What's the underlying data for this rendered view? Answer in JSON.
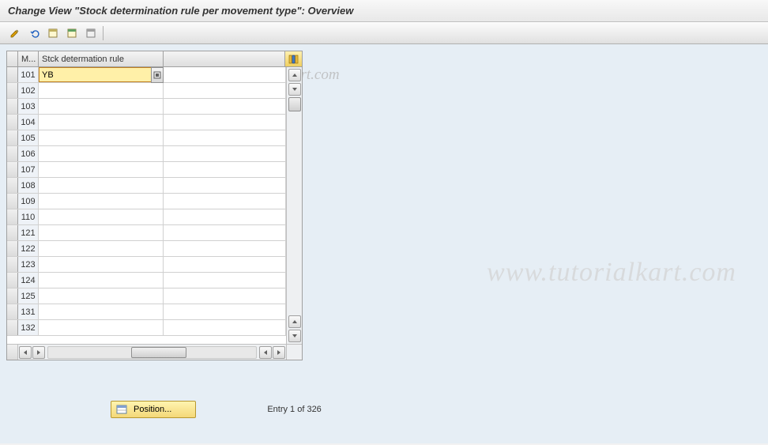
{
  "title": "Change View \"Stock determination rule per movement type\": Overview",
  "watermark_small": "© www.tutorialkart.com",
  "watermark_large": "www.tutorialkart.com",
  "columns": {
    "mvt": "M...",
    "rule": "Stck determation rule"
  },
  "rows": [
    {
      "mvt": "101",
      "rule": "YB",
      "active": true
    },
    {
      "mvt": "102",
      "rule": ""
    },
    {
      "mvt": "103",
      "rule": ""
    },
    {
      "mvt": "104",
      "rule": ""
    },
    {
      "mvt": "105",
      "rule": ""
    },
    {
      "mvt": "106",
      "rule": ""
    },
    {
      "mvt": "107",
      "rule": ""
    },
    {
      "mvt": "108",
      "rule": ""
    },
    {
      "mvt": "109",
      "rule": ""
    },
    {
      "mvt": "110",
      "rule": ""
    },
    {
      "mvt": "121",
      "rule": ""
    },
    {
      "mvt": "122",
      "rule": ""
    },
    {
      "mvt": "123",
      "rule": ""
    },
    {
      "mvt": "124",
      "rule": ""
    },
    {
      "mvt": "125",
      "rule": ""
    },
    {
      "mvt": "131",
      "rule": ""
    },
    {
      "mvt": "132",
      "rule": ""
    }
  ],
  "footer": {
    "position_label": "Position...",
    "entry_text": "Entry 1 of 326"
  }
}
